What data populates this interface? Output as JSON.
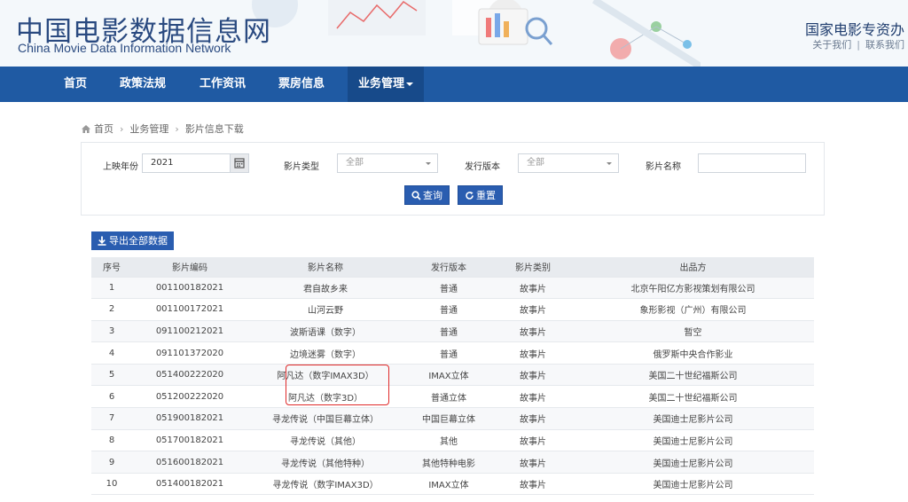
{
  "header": {
    "title": "中国电影数据信息网",
    "subtitle": "China Movie Data Information Network",
    "org": "国家电影专资办",
    "links": [
      "关于我们",
      "联系我们"
    ]
  },
  "nav": {
    "items": [
      "首页",
      "政策法规",
      "工作资讯",
      "票房信息",
      "业务管理"
    ],
    "active_index": 4
  },
  "breadcrumb": [
    "首页",
    "业务管理",
    "影片信息下载"
  ],
  "search": {
    "year_label": "上映年份",
    "year_value": "2021",
    "type_label": "影片类型",
    "type_value": "全部",
    "version_label": "发行版本",
    "version_value": "全部",
    "name_label": "影片名称",
    "name_value": "",
    "query_button": "查询",
    "reset_button": "重置"
  },
  "export_button": "导出全部数据",
  "table": {
    "columns": [
      "序号",
      "影片编码",
      "影片名称",
      "发行版本",
      "影片类别",
      "出品方"
    ],
    "rows": [
      [
        "1",
        "001100182021",
        "君自故乡来",
        "普通",
        "故事片",
        "北京午阳亿方影视策划有限公司"
      ],
      [
        "2",
        "001100172021",
        "山河云野",
        "普通",
        "故事片",
        "象形影视（广州）有限公司"
      ],
      [
        "3",
        "091100212021",
        "波斯语课（数字）",
        "普通",
        "故事片",
        "暂空"
      ],
      [
        "4",
        "091101372020",
        "边境迷雾（数字）",
        "普通",
        "故事片",
        "俄罗斯中央合作影业"
      ],
      [
        "5",
        "051400222020",
        "阿凡达（数字IMAX3D）",
        "IMAX立体",
        "故事片",
        "美国二十世纪福斯公司"
      ],
      [
        "6",
        "051200222020",
        "阿凡达（数字3D）",
        "普通立体",
        "故事片",
        "美国二十世纪福斯公司"
      ],
      [
        "7",
        "051900182021",
        "寻龙传说（中国巨幕立体）",
        "中国巨幕立体",
        "故事片",
        "美国迪士尼影片公司"
      ],
      [
        "8",
        "051700182021",
        "寻龙传说（其他）",
        "其他",
        "故事片",
        "美国迪士尼影片公司"
      ],
      [
        "9",
        "051600182021",
        "寻龙传说（其他特种）",
        "其他特种电影",
        "故事片",
        "美国迪士尼影片公司"
      ],
      [
        "10",
        "051400182021",
        "寻龙传说（数字IMAX3D）",
        "IMAX立体",
        "故事片",
        "美国迪士尼影片公司"
      ]
    ]
  },
  "colors": {
    "nav_bg": "#1f5aa3",
    "button_bg": "#2a5db0",
    "title_color": "#2a4a80",
    "highlight_border": "#e02a2a"
  }
}
